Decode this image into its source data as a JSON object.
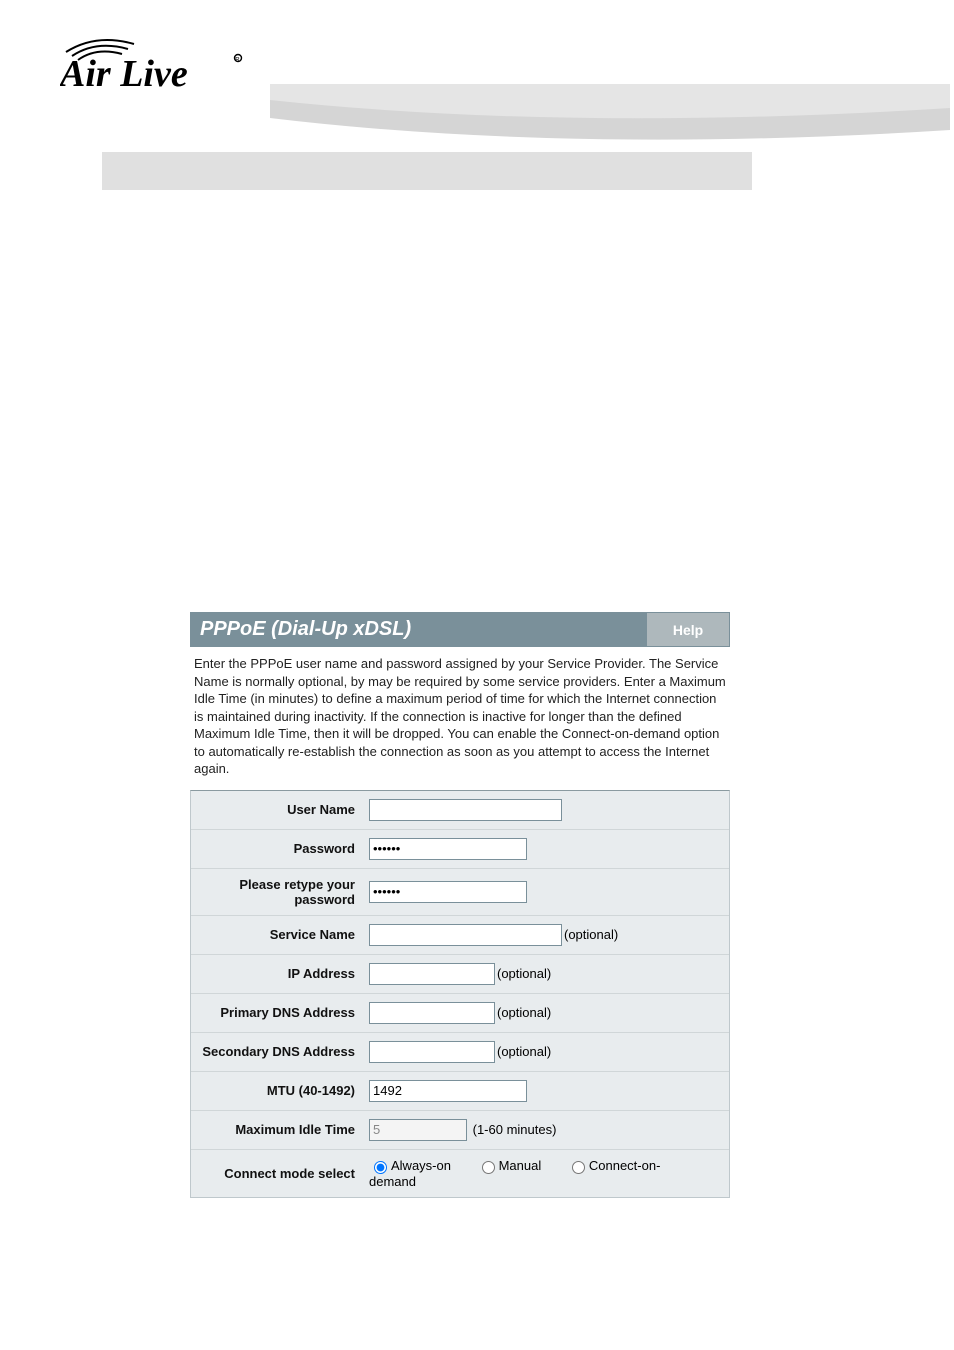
{
  "brand": "Air Live",
  "panel": {
    "title": "PPPoE (Dial-Up xDSL)",
    "help": "Help",
    "description": "Enter the PPPoE user name and password assigned by your Service Provider. The Service Name is normally optional, by may be required by some service providers. Enter a Maximum Idle Time (in minutes) to define a maximum period of time for which the Internet connection is maintained during inactivity. If the connection is inactive for longer than the defined Maximum Idle Time, then it will be dropped. You can enable the Connect-on-demand option to automatically re-establish the connection as soon as you attempt to access the Internet again."
  },
  "labels": {
    "username": "User Name",
    "password": "Password",
    "retype": "Please retype your password",
    "service": "Service Name",
    "ip": "IP Address",
    "dns1": "Primary DNS Address",
    "dns2": "Secondary DNS Address",
    "mtu": "MTU (40-1492)",
    "idle": "Maximum Idle Time",
    "mode": "Connect mode select"
  },
  "values": {
    "username": "",
    "password": "••••••",
    "retype": "••••••",
    "service": "",
    "ip": "",
    "dns1": "",
    "dns2": "",
    "mtu": "1492",
    "idle": "5"
  },
  "hints": {
    "optional": "(optional)",
    "idle": "(1-60 minutes)"
  },
  "modes": {
    "always": "Always-on",
    "manual": "Manual",
    "demand": "Connect-on-demand",
    "selected": "always"
  }
}
